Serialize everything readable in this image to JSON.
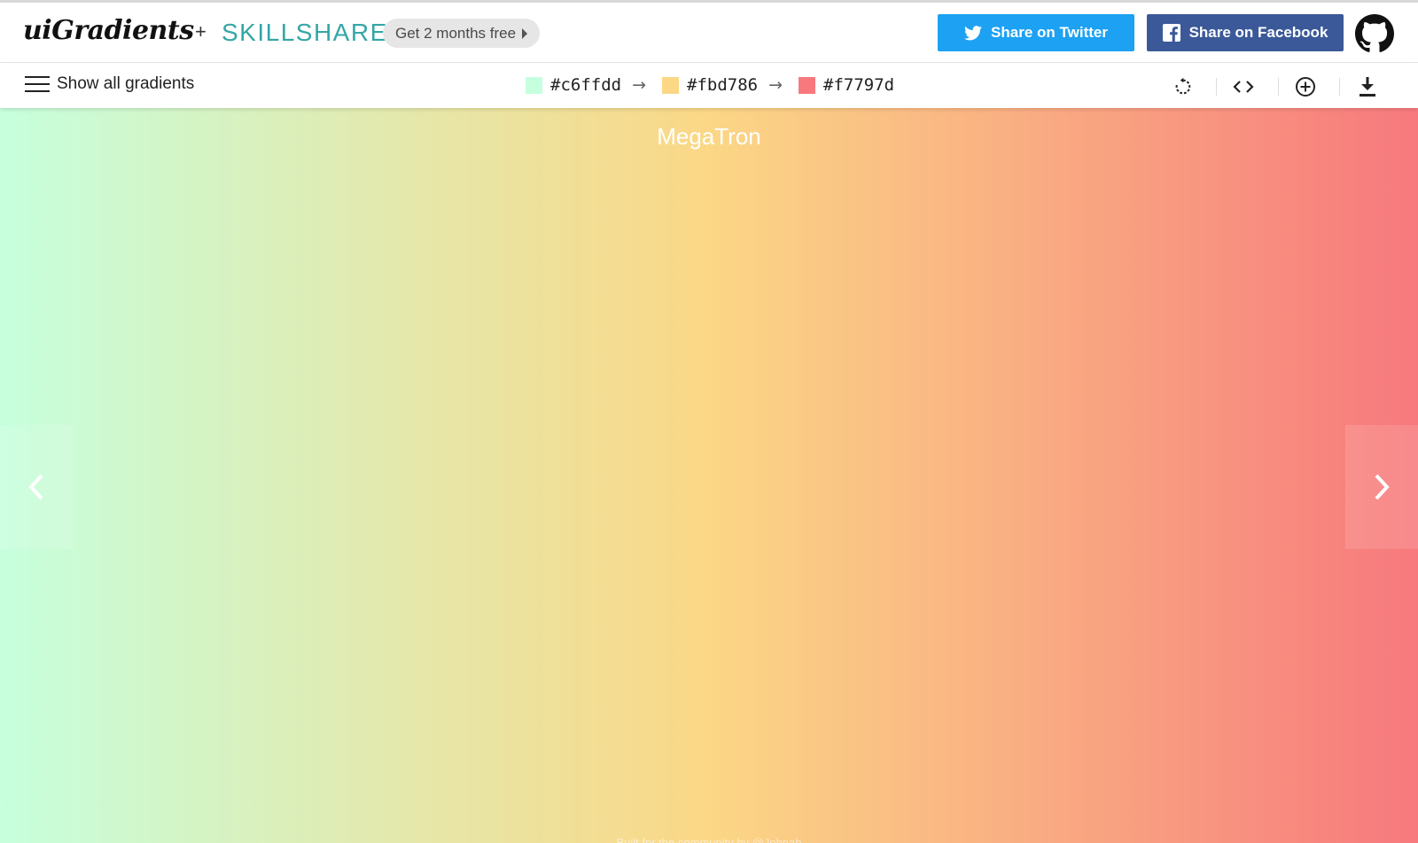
{
  "header": {
    "logo": "uiGradients",
    "plus": "+",
    "partner": "SKILLSHARE",
    "promo": "Get 2 months free",
    "twitter_label": "Share on Twitter",
    "facebook_label": "Share on Facebook",
    "github_icon": "github-icon"
  },
  "toolbar": {
    "show_all_label": "Show all gradients",
    "colors": [
      {
        "hex": "#c6ffdd"
      },
      {
        "hex": "#fbd786"
      },
      {
        "hex": "#f7797d"
      }
    ],
    "arrow": "→",
    "icons": [
      "rotate-icon",
      "code-icon",
      "add-icon",
      "download-icon"
    ]
  },
  "gradient": {
    "name": "MegaTron",
    "stops": [
      "#c6ffdd",
      "#fbd786",
      "#f7797d"
    ],
    "direction": "to right",
    "footer": "Built for the community by @Johnab"
  },
  "colors": {
    "twitter": "#1da1f2",
    "facebook": "#3b5998",
    "skillshare": "#35a6a6"
  }
}
